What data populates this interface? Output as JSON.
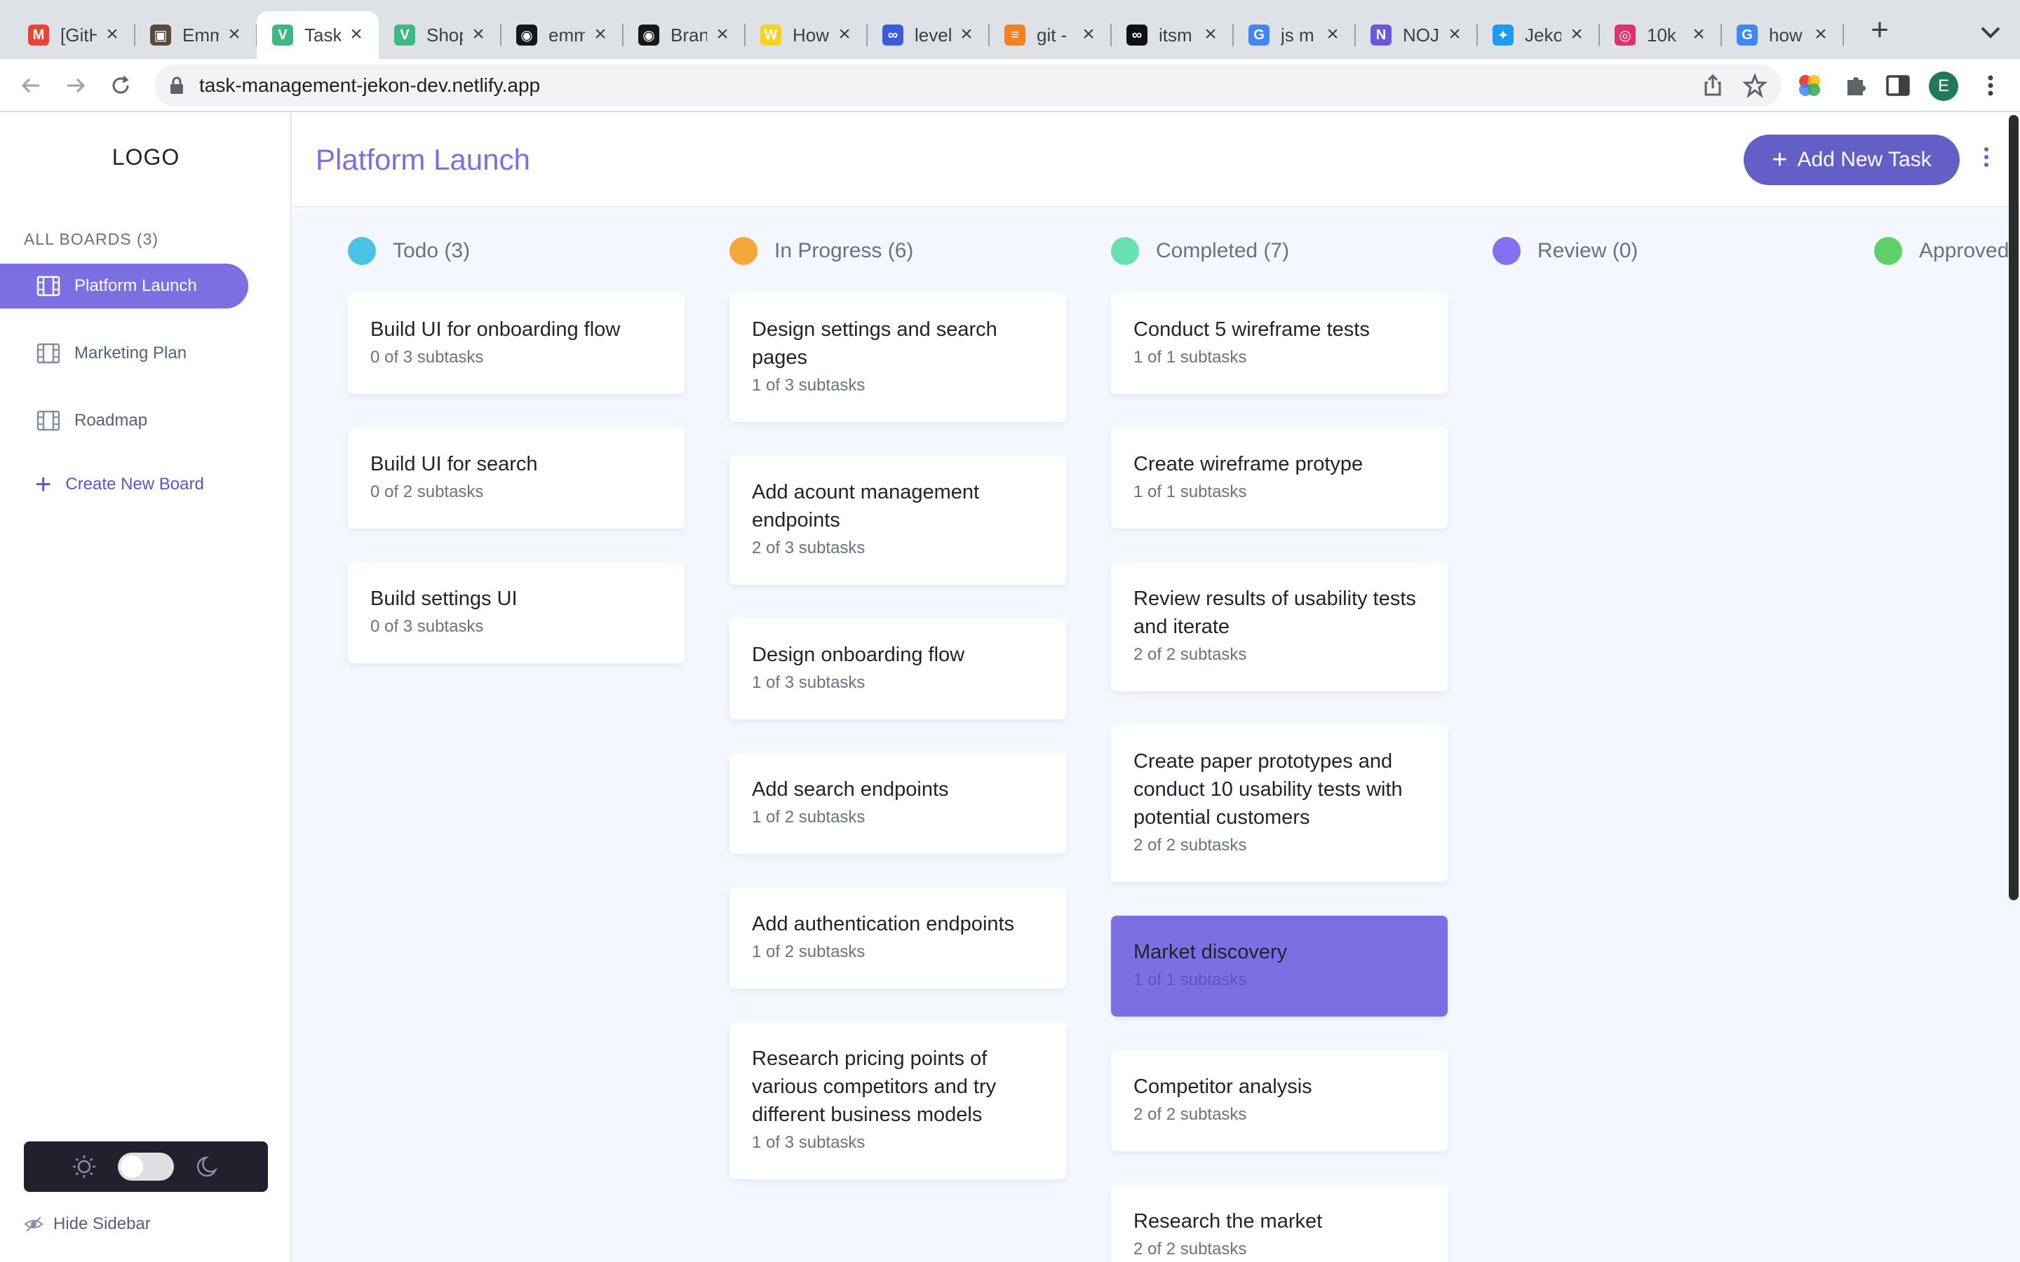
{
  "browser": {
    "tabs": [
      {
        "title": "[GitHub]",
        "favicon": "gmail-icon",
        "color": "#ea4335",
        "glyph": "M"
      },
      {
        "title": "Emma",
        "favicon": "photo-icon",
        "color": "#5a4a3a",
        "glyph": "▣"
      },
      {
        "title": "Task",
        "favicon": "vue-icon",
        "color": "#41b883",
        "glyph": "V",
        "active": true
      },
      {
        "title": "Shop",
        "favicon": "vue-icon",
        "color": "#41b883",
        "glyph": "V"
      },
      {
        "title": "emma",
        "favicon": "github-icon",
        "color": "#181717",
        "glyph": "◉"
      },
      {
        "title": "Brand",
        "favicon": "github-icon",
        "color": "#181717",
        "glyph": "◉"
      },
      {
        "title": "How",
        "favicon": "w-icon",
        "color": "#f7d31c",
        "glyph": "W"
      },
      {
        "title": "level",
        "favicon": "infinity-icon",
        "color": "#3b5bdb",
        "glyph": "∞"
      },
      {
        "title": "git -",
        "favicon": "stackoverflow-icon",
        "color": "#f48024",
        "glyph": "≡"
      },
      {
        "title": "itsm",
        "favicon": "infinity-icon",
        "color": "#111111",
        "glyph": "∞"
      },
      {
        "title": "js m",
        "favicon": "google-icon",
        "color": "#4285f4",
        "glyph": "G"
      },
      {
        "title": "NOJ",
        "favicon": "notion-icon",
        "color": "#6b57d9",
        "glyph": "N"
      },
      {
        "title": "Jeko",
        "favicon": "twitter-icon",
        "color": "#1d9bf0",
        "glyph": "✦"
      },
      {
        "title": "10k",
        "favicon": "instagram-icon",
        "color": "#e1306c",
        "glyph": "◎"
      },
      {
        "title": "how",
        "favicon": "google-icon",
        "color": "#4285f4",
        "glyph": "G"
      }
    ],
    "url": "task-management-jekon-dev.netlify.app",
    "profile_initial": "E"
  },
  "sidebar": {
    "logo": "LOGO",
    "boards_header": "ALL BOARDS (3)",
    "boards": [
      {
        "label": "Platform Launch",
        "active": true
      },
      {
        "label": "Marketing Plan",
        "active": false
      },
      {
        "label": "Roadmap",
        "active": false
      }
    ],
    "create_board": "Create New Board",
    "hide_sidebar": "Hide Sidebar"
  },
  "header": {
    "title": "Platform Launch",
    "add_task": "Add New Task"
  },
  "columns": [
    {
      "name": "Todo (3)",
      "color": "#49c4e5",
      "cards": [
        {
          "title": "Build UI for onboarding flow",
          "subtasks": "0 of 3 subtasks"
        },
        {
          "title": "Build UI for search",
          "subtasks": "0 of 2 subtasks"
        },
        {
          "title": "Build settings UI",
          "subtasks": "0 of 3 subtasks"
        }
      ]
    },
    {
      "name": "In Progress (6)",
      "color": "#f5a73c",
      "cards": [
        {
          "title": "Design settings and search pages",
          "subtasks": "1 of 3 subtasks"
        },
        {
          "title": "Add acount management endpoints",
          "subtasks": "2 of 3 subtasks"
        },
        {
          "title": "Design onboarding flow",
          "subtasks": "1 of 3 subtasks"
        },
        {
          "title": "Add search endpoints",
          "subtasks": "1 of 2 subtasks"
        },
        {
          "title": "Add authentication endpoints",
          "subtasks": "1 of 2 subtasks"
        },
        {
          "title": "Research pricing points of various competitors and try different business models",
          "subtasks": "1 of 3 subtasks"
        }
      ]
    },
    {
      "name": "Completed (7)",
      "color": "#67e2ae",
      "cards": [
        {
          "title": "Conduct 5 wireframe tests",
          "subtasks": "1 of 1 subtasks"
        },
        {
          "title": "Create wireframe protype",
          "subtasks": "1 of 1 subtasks"
        },
        {
          "title": "Review results of usability tests and iterate",
          "subtasks": "2 of 2 subtasks"
        },
        {
          "title": "Create paper prototypes and conduct 10 usability tests with potential customers",
          "subtasks": "2 of 2 subtasks"
        },
        {
          "title": "Market discovery",
          "subtasks": "1 of 1 subtasks",
          "highlighted": true
        },
        {
          "title": "Competitor analysis",
          "subtasks": "2 of 2 subtasks"
        },
        {
          "title": "Research the market",
          "subtasks": "2 of 2 subtasks"
        }
      ]
    },
    {
      "name": "Review (0)",
      "color": "#8471f2",
      "cards": []
    },
    {
      "name": "Approved",
      "color": "#5fd068",
      "cards": []
    }
  ]
}
